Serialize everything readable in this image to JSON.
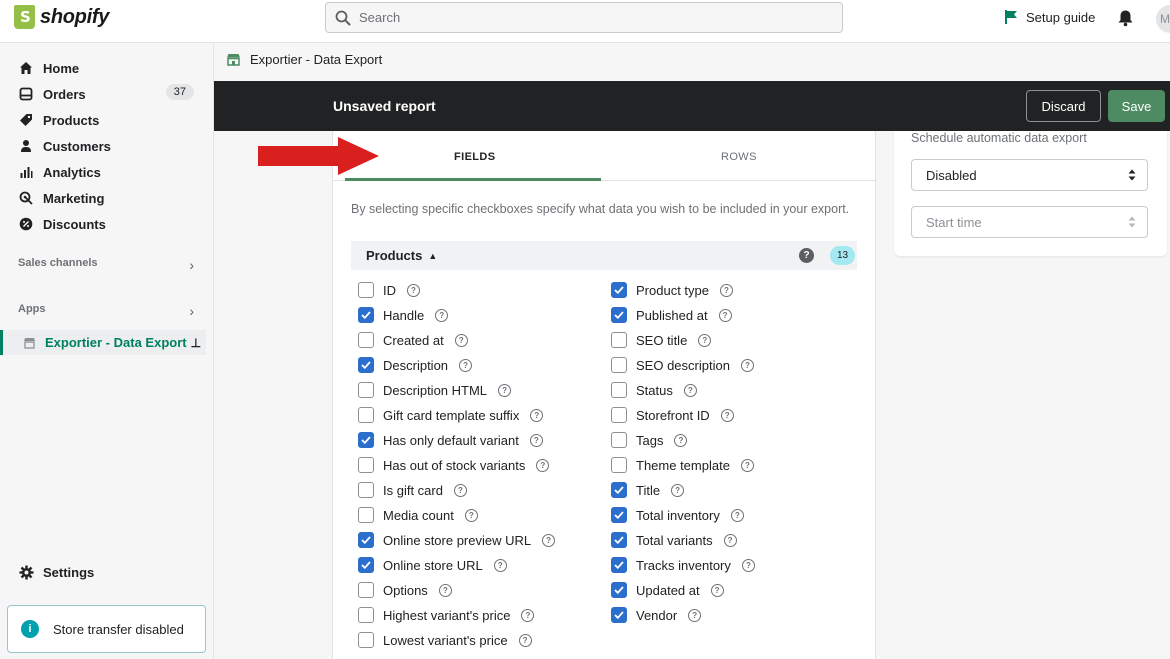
{
  "app": {
    "logo_text": "shopify"
  },
  "topbar": {
    "search_placeholder": "Search",
    "setup_guide": "Setup guide",
    "avatar_initial": "M"
  },
  "sidebar": {
    "items": [
      {
        "label": "Home",
        "icon": "home-icon"
      },
      {
        "label": "Orders",
        "icon": "orders-icon",
        "badge": "37"
      },
      {
        "label": "Products",
        "icon": "tag-icon"
      },
      {
        "label": "Customers",
        "icon": "person-icon"
      },
      {
        "label": "Analytics",
        "icon": "bar-chart-icon"
      },
      {
        "label": "Marketing",
        "icon": "megaphone-icon"
      },
      {
        "label": "Discounts",
        "icon": "discount-icon"
      }
    ],
    "sales_channels": "Sales channels",
    "apps": "Apps",
    "active_app": "Exportier - Data Export",
    "settings": "Settings",
    "store_transfer": "Store transfer disabled"
  },
  "breadcrumb": "Exportier - Data Export",
  "savebar": {
    "title": "Unsaved report",
    "discard": "Discard",
    "save": "Save"
  },
  "tabs": {
    "fields": "FIELDS",
    "rows": "ROWS"
  },
  "description": "By selecting specific checkboxes specify what data you wish to be included in your export.",
  "section": {
    "title": "Products",
    "count": "13"
  },
  "fields_left": [
    {
      "label": "ID",
      "checked": false
    },
    {
      "label": "Handle",
      "checked": true
    },
    {
      "label": "Created at",
      "checked": false
    },
    {
      "label": "Description",
      "checked": true
    },
    {
      "label": "Description HTML",
      "checked": false
    },
    {
      "label": "Gift card template suffix",
      "checked": false
    },
    {
      "label": "Has only default variant",
      "checked": true
    },
    {
      "label": "Has out of stock variants",
      "checked": false
    },
    {
      "label": "Is gift card",
      "checked": false
    },
    {
      "label": "Media count",
      "checked": false
    },
    {
      "label": "Online store preview URL",
      "checked": true
    },
    {
      "label": "Online store URL",
      "checked": true
    },
    {
      "label": "Options",
      "checked": false
    },
    {
      "label": "Highest variant's price",
      "checked": false
    },
    {
      "label": "Lowest variant's price",
      "checked": false
    }
  ],
  "fields_right": [
    {
      "label": "Product type",
      "checked": true
    },
    {
      "label": "Published at",
      "checked": true
    },
    {
      "label": "SEO title",
      "checked": false
    },
    {
      "label": "SEO description",
      "checked": false
    },
    {
      "label": "Status",
      "checked": false
    },
    {
      "label": "Storefront ID",
      "checked": false
    },
    {
      "label": "Tags",
      "checked": false
    },
    {
      "label": "Theme template",
      "checked": false
    },
    {
      "label": "Title",
      "checked": true
    },
    {
      "label": "Total inventory",
      "checked": true
    },
    {
      "label": "Total variants",
      "checked": true
    },
    {
      "label": "Tracks inventory",
      "checked": true
    },
    {
      "label": "Updated at",
      "checked": true
    },
    {
      "label": "Vendor",
      "checked": true
    }
  ],
  "schedule": {
    "label": "Schedule automatic data export",
    "value": "Disabled",
    "start_time_placeholder": "Start time"
  },
  "colors": {
    "accent_green": "#4e8a62",
    "checkbox_blue": "#2c6ecb",
    "arrow_red": "#d9201f",
    "logo_green": "#95bf47"
  }
}
